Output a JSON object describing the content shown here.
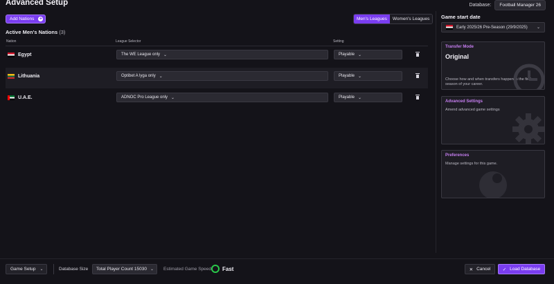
{
  "header": {
    "title": "Advanced Setup",
    "database_label": "Database:",
    "database_value": "Football Manager 26"
  },
  "toolbar": {
    "add_nations_label": "Add Nations",
    "tabs": [
      {
        "label": "Men's Leagues",
        "active": true
      },
      {
        "label": "Women's Leagues",
        "active": false
      }
    ]
  },
  "nations": {
    "section_title": "Active Men's Nations",
    "count": "(3)",
    "columns": {
      "nation": "Nation",
      "league": "League Selector",
      "setting": "Setting"
    },
    "rows": [
      {
        "nation": "Egypt",
        "flag": "egypt-flag-icon",
        "league": "The WE League only",
        "setting": "Playable"
      },
      {
        "nation": "Lithuania",
        "flag": "lithuania-flag-icon",
        "league": "Optibet A lyga only",
        "setting": "Playable"
      },
      {
        "nation": "U.A.E.",
        "flag": "uae-flag-icon",
        "league": "ADNOC Pro League only",
        "setting": "Playable"
      }
    ]
  },
  "sidebar": {
    "game_start_label": "Game start date",
    "game_start_value": "Early 2025/26 Pre-Season (29/9/2025)",
    "cards": [
      {
        "title": "Transfer Mode",
        "value": "Original",
        "desc": "Choose how and when transfers happen in the first season of your career.",
        "icon": "clock-icon"
      },
      {
        "title": "Advanced Settings",
        "value": "",
        "desc": "Amend advanced game settings",
        "icon": "gear-icon"
      },
      {
        "title": "Preferences",
        "value": "",
        "desc": "Manage settings for this game.",
        "icon": "preferences-icon"
      }
    ]
  },
  "footer": {
    "game_setup_label": "Game Setup",
    "db_size_label": "Database Size",
    "player_count_label": "Total Player Count 15030",
    "speed_label": "Estimated Game Speed",
    "speed_value": "Fast",
    "cancel_label": "Cancel",
    "load_label": "Load Database"
  },
  "colors": {
    "accent": "#7a3df0",
    "card_title": "#c67ef0",
    "speed_indicator": "#29c94a",
    "background": "#141319"
  }
}
